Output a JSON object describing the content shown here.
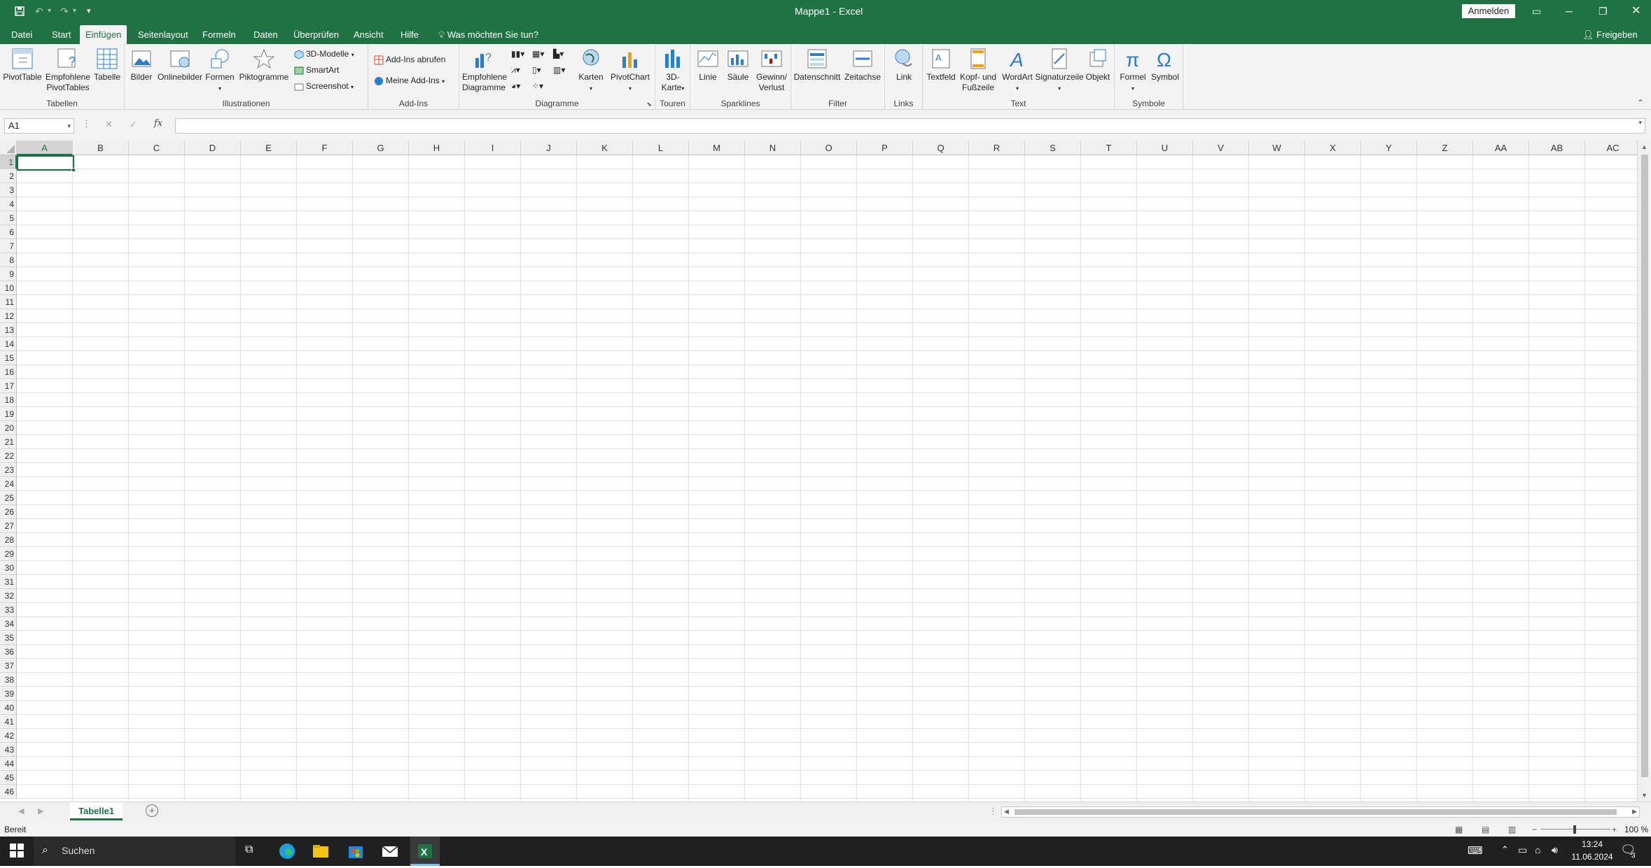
{
  "window": {
    "title": "Mappe1 - Excel",
    "signin_label": "Anmelden",
    "share_label": "Freigeben"
  },
  "tabs": [
    {
      "label": "Datei"
    },
    {
      "label": "Start"
    },
    {
      "label": "Einfügen",
      "active": true
    },
    {
      "label": "Seitenlayout"
    },
    {
      "label": "Formeln"
    },
    {
      "label": "Daten"
    },
    {
      "label": "Überprüfen"
    },
    {
      "label": "Ansicht"
    },
    {
      "label": "Hilfe"
    }
  ],
  "tell_me": "Was möchten Sie tun?",
  "ribbon": {
    "tabellen": {
      "label": "Tabellen",
      "pivottable": "PivotTable",
      "empf_pivot_1": "Empfohlene",
      "empf_pivot_2": "PivotTables",
      "tabelle": "Tabelle"
    },
    "illustrationen": {
      "label": "Illustrationen",
      "bilder": "Bilder",
      "onlinebilder": "Onlinebilder",
      "formen": "Formen",
      "piktogramme": "Piktogramme",
      "modelle3d": "3D-Modelle",
      "smartart": "SmartArt",
      "screenshot": "Screenshot"
    },
    "addins": {
      "label": "Add-Ins",
      "abrufen": "Add-Ins abrufen",
      "meine": "Meine Add-Ins"
    },
    "diagramme": {
      "label": "Diagramme",
      "empf_1": "Empfohlene",
      "empf_2": "Diagramme",
      "karten": "Karten",
      "pivotchart": "PivotChart"
    },
    "touren": {
      "label": "Touren",
      "karte_1": "3D-",
      "karte_2": "Karte"
    },
    "sparklines": {
      "label": "Sparklines",
      "linie": "Linie",
      "saeule": "Säule",
      "gewinn_1": "Gewinn/",
      "gewinn_2": "Verlust"
    },
    "filter": {
      "label": "Filter",
      "datenschnitt": "Datenschnitt",
      "zeitachse": "Zeitachse"
    },
    "links": {
      "label": "Links",
      "link": "Link"
    },
    "text": {
      "label": "Text",
      "textfeld": "Textfeld",
      "kopf_1": "Kopf- und",
      "kopf_2": "Fußzeile",
      "wordart": "WordArt",
      "signatur": "Signaturzeile",
      "objekt": "Objekt"
    },
    "symbole": {
      "label": "Symbole",
      "formel": "Formel",
      "symbol": "Symbol"
    }
  },
  "namebox": "A1",
  "fx_label": "fx",
  "columns": [
    "A",
    "B",
    "C",
    "D",
    "E",
    "F",
    "G",
    "H",
    "I",
    "J",
    "K",
    "L",
    "M",
    "N",
    "O",
    "P",
    "Q",
    "R",
    "S",
    "T",
    "U",
    "V",
    "W",
    "X",
    "Y",
    "Z",
    "AA",
    "AB",
    "AC"
  ],
  "rows": [
    "1",
    "2",
    "3",
    "4",
    "5",
    "6",
    "7",
    "8",
    "9",
    "10",
    "11",
    "12",
    "13",
    "14",
    "15",
    "16",
    "17",
    "18",
    "19",
    "20",
    "21",
    "22",
    "23",
    "24",
    "25",
    "26",
    "27",
    "28",
    "29",
    "30",
    "31",
    "32",
    "33",
    "34",
    "35",
    "36",
    "37",
    "38",
    "39",
    "40",
    "41",
    "42",
    "43",
    "44",
    "45",
    "46"
  ],
  "sheet_tab": "Tabelle1",
  "status": {
    "ready": "Bereit",
    "zoom": "100 %"
  },
  "taskbar": {
    "search": "Suchen",
    "time": "13:24",
    "date": "11.06.2024",
    "notifications": "3"
  },
  "colors": {
    "brand": "#1f7244",
    "taskbar": "#202020"
  }
}
